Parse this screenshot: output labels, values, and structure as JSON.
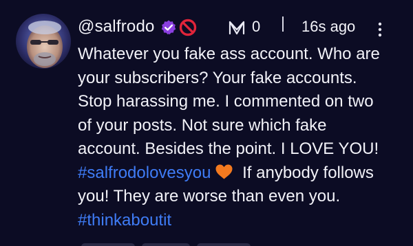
{
  "comment": {
    "username": "@salfrodo",
    "reactions_count": "0",
    "timestamp": "16s ago",
    "body_lines": [
      "Whatever you fake ass account. Who are",
      "your subscribers? Your fake accounts.",
      "Stop harassing me. I commented on two",
      "of your posts. Not sure which fake",
      "account. Besides the point. I LOVE YOU!"
    ],
    "hashtag_1": "#salfrodolovesyou",
    "after_hashtag_1": " If anybody follows",
    "line_8": "you! They are worse than even you.",
    "hashtag_2": "#thinkaboutit"
  },
  "icons": {
    "verified": "verified-badge-icon",
    "banned": "prohibited-icon",
    "reaction": "m-logo-icon",
    "menu": "kebab-menu-icon",
    "heart": "orange-heart-emoji"
  },
  "colors": {
    "background": "#0c0c24",
    "text": "#f2f2f8",
    "hashtag": "#3f7cf6",
    "verified": "#8b3fe0",
    "banned": "#e0243a",
    "heart": "#f47a1f"
  }
}
